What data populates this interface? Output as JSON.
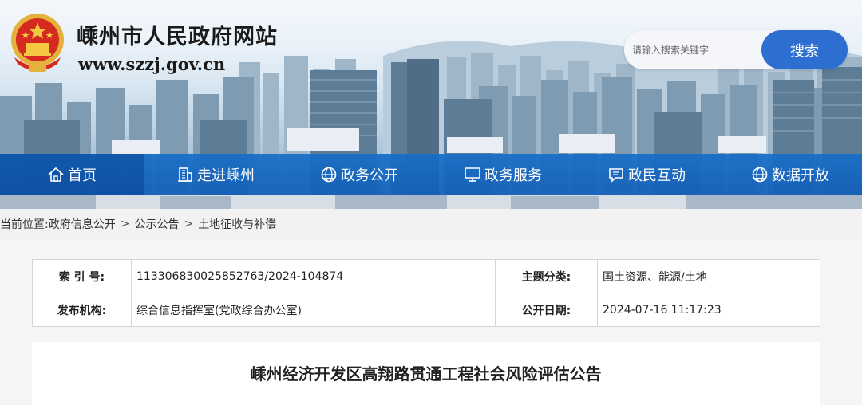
{
  "header": {
    "site_title": "嵊州市人民政府网站",
    "site_url": "www.szzj.gov.cn",
    "emblem_icon": "national-emblem-icon",
    "search": {
      "placeholder": "请输入搜索关键字",
      "button_label": "搜索"
    }
  },
  "nav": {
    "items": [
      {
        "label": "首页",
        "icon": "home-icon"
      },
      {
        "label": "走进嵊州",
        "icon": "building-icon"
      },
      {
        "label": "政务公开",
        "icon": "globe-icon"
      },
      {
        "label": "政务服务",
        "icon": "monitor-icon"
      },
      {
        "label": "政民互动",
        "icon": "chat-icon"
      },
      {
        "label": "数据开放",
        "icon": "globe-icon"
      }
    ],
    "active_index": 0
  },
  "breadcrumb": {
    "prefix": "当前位置:",
    "items": [
      "政府信息公开",
      "公示公告",
      "土地征收与补偿"
    ],
    "separator": ">"
  },
  "meta": {
    "index_label": "索 引 号:",
    "index_value": "113306830025852763/2024-104874",
    "category_label": "主题分类:",
    "category_value": "国土资源、能源/土地",
    "publisher_label": "发布机构:",
    "publisher_value": "综合信息指挥室(党政综合办公室)",
    "date_label": "公开日期:",
    "date_value": "2024-07-16 11:17:23"
  },
  "article": {
    "title": "嵊州经济开发区高翔路贯通工程社会风险评估公告"
  },
  "colors": {
    "nav_blue": "#1a6ec6",
    "search_button": "#2d6fd0",
    "breadcrumb_bg": "#f2f2f2"
  }
}
